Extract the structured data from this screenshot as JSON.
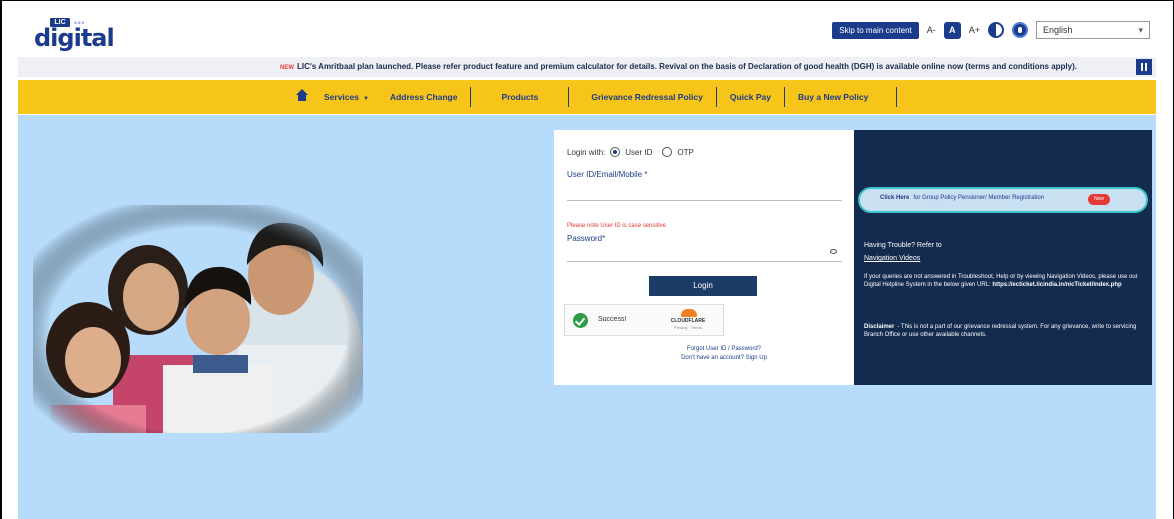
{
  "header": {
    "logo_brand": "LIC",
    "logo_word": "digital",
    "skip_label": "Skip to main content",
    "font_small": "A-",
    "font_normal": "A",
    "font_large": "A+",
    "language": "English",
    "icons": [
      "contrast-icon",
      "accessibility-icon",
      "chevron-down-icon"
    ]
  },
  "ticker": {
    "new_tag": "NEW",
    "text": "LIC's Amritbaal plan launched. Please refer product feature and premium calculator for details.  Revival on the basis of Declaration of good health (DGH) is available online now (terms and conditions apply)."
  },
  "nav": {
    "items": [
      {
        "label": "Services",
        "has_caret": true
      },
      {
        "label": "Address Change"
      },
      {
        "label": "Products"
      },
      {
        "label": "Grievance Redressal Policy"
      },
      {
        "label": "Quick Pay"
      },
      {
        "label": "Buy a New Policy"
      }
    ]
  },
  "login": {
    "login_with": "Login with:",
    "option_user_id": "User ID",
    "option_otp": "OTP",
    "user_label": "User ID/Email/Mobile *",
    "case_hint": "Please note User ID is case sensitive",
    "password_label": "Password*",
    "login_button": "Login",
    "captcha_status": "Success!",
    "captcha_brand": "CLOUDFLARE",
    "captcha_links": "Privacy · Terms",
    "forgot": "Forgot User ID / Password?",
    "signup": "Don't have an account? Sign Up"
  },
  "info": {
    "click_here": "Click Here",
    "registration": "for Group Policy Pensioner/ Member Registration",
    "new_badge": "New",
    "trouble": "Having Trouble? Refer to",
    "videos_link": "Navigation Videos",
    "queries": "If your queries are not answered in Troubleshoot, Help or by viewing Navigation Videos, please use our Digital Helpline System in the below given URL:",
    "url": "https://ecticket.licindia.in/nicTicket/index.php",
    "disclaimer_label": "Disclaimer",
    "disclaimer": "- This is not a part of our grievance redressal system. For any grievance, write to servicing Branch Office or use other available channels."
  },
  "colors": {
    "brand_blue": "#1b3c8a",
    "nav_yellow": "#f7c41a",
    "main_bg": "#b7dcfb",
    "panel_navy": "#122b4e",
    "accent_cyan": "#3bc6cf",
    "success_green": "#2e9b47"
  }
}
